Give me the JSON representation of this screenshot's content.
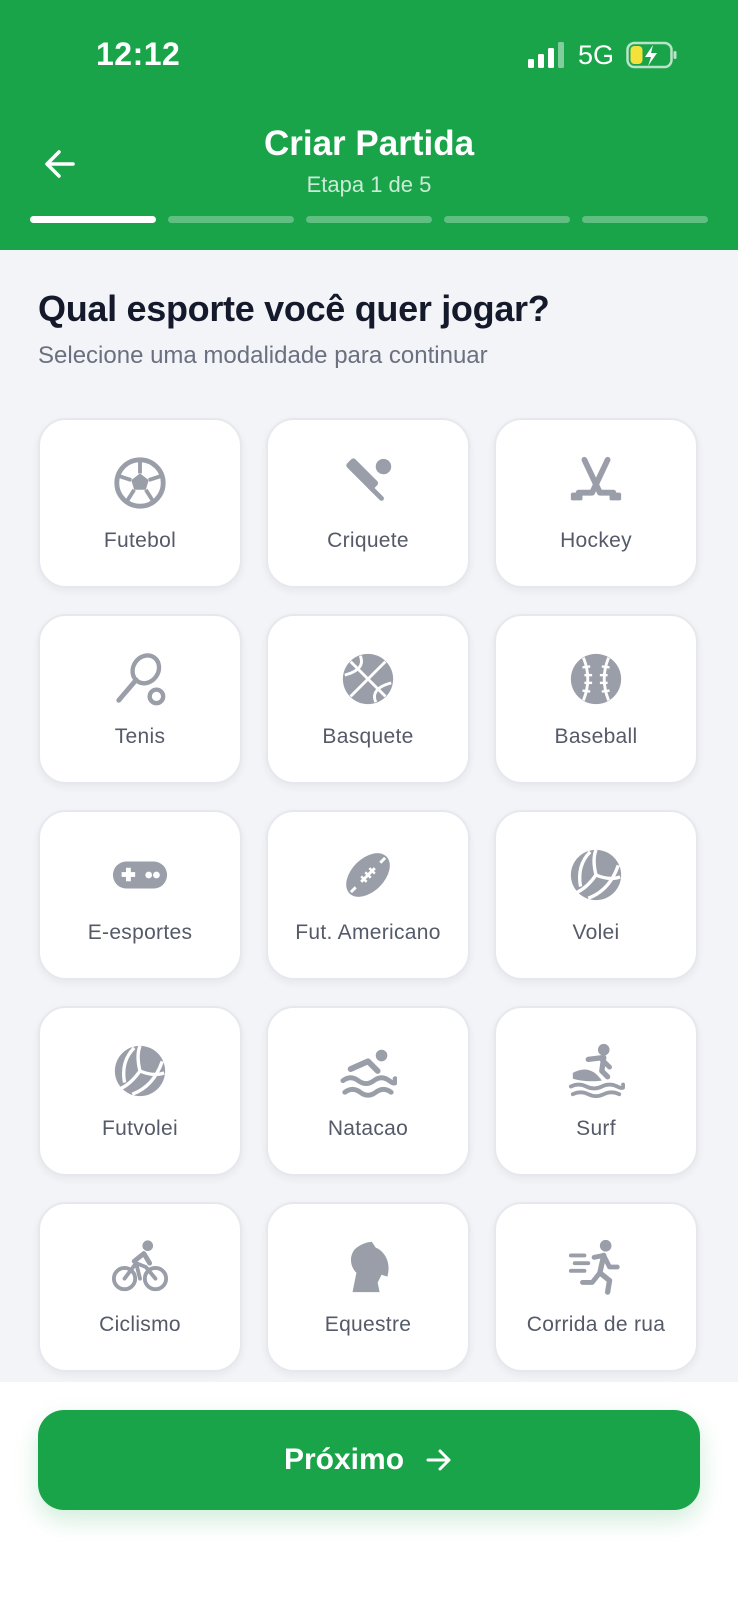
{
  "status_bar": {
    "time": "12:12",
    "network": "5G",
    "signal_icon": "signal-bars-icon",
    "battery_icon": "battery-charging-icon"
  },
  "header": {
    "title": "Criar Partida",
    "subtitle": "Etapa 1 de 5",
    "back_icon": "arrow-left-icon",
    "progress": {
      "current_step": 1,
      "total_steps": 5
    }
  },
  "main": {
    "question": "Qual esporte você quer jogar?",
    "instruction": "Selecione uma modalidade para continuar",
    "sports": [
      {
        "label": "Futebol",
        "icon": "soccer-ball-icon"
      },
      {
        "label": "Criquete",
        "icon": "cricket-icon"
      },
      {
        "label": "Hockey",
        "icon": "hockey-sticks-icon"
      },
      {
        "label": "Tenis",
        "icon": "tennis-racket-icon"
      },
      {
        "label": "Basquete",
        "icon": "basketball-icon"
      },
      {
        "label": "Baseball",
        "icon": "baseball-icon"
      },
      {
        "label": "E-esportes",
        "icon": "gamepad-icon"
      },
      {
        "label": "Fut. Americano",
        "icon": "football-icon"
      },
      {
        "label": "Volei",
        "icon": "volleyball-icon"
      },
      {
        "label": "Futvolei",
        "icon": "volleyball-icon"
      },
      {
        "label": "Natacao",
        "icon": "swimmer-icon"
      },
      {
        "label": "Surf",
        "icon": "surfer-icon"
      },
      {
        "label": "Ciclismo",
        "icon": "cyclist-icon"
      },
      {
        "label": "Equestre",
        "icon": "horse-head-icon"
      },
      {
        "label": "Corrida de rua",
        "icon": "runner-icon"
      }
    ]
  },
  "footer": {
    "next_label": "Próximo",
    "next_icon": "arrow-right-icon"
  },
  "colors": {
    "brand_green": "#1aa44a",
    "background": "#f3f4f7",
    "icon_gray": "#9a9ea9",
    "heading": "#141a2b"
  }
}
